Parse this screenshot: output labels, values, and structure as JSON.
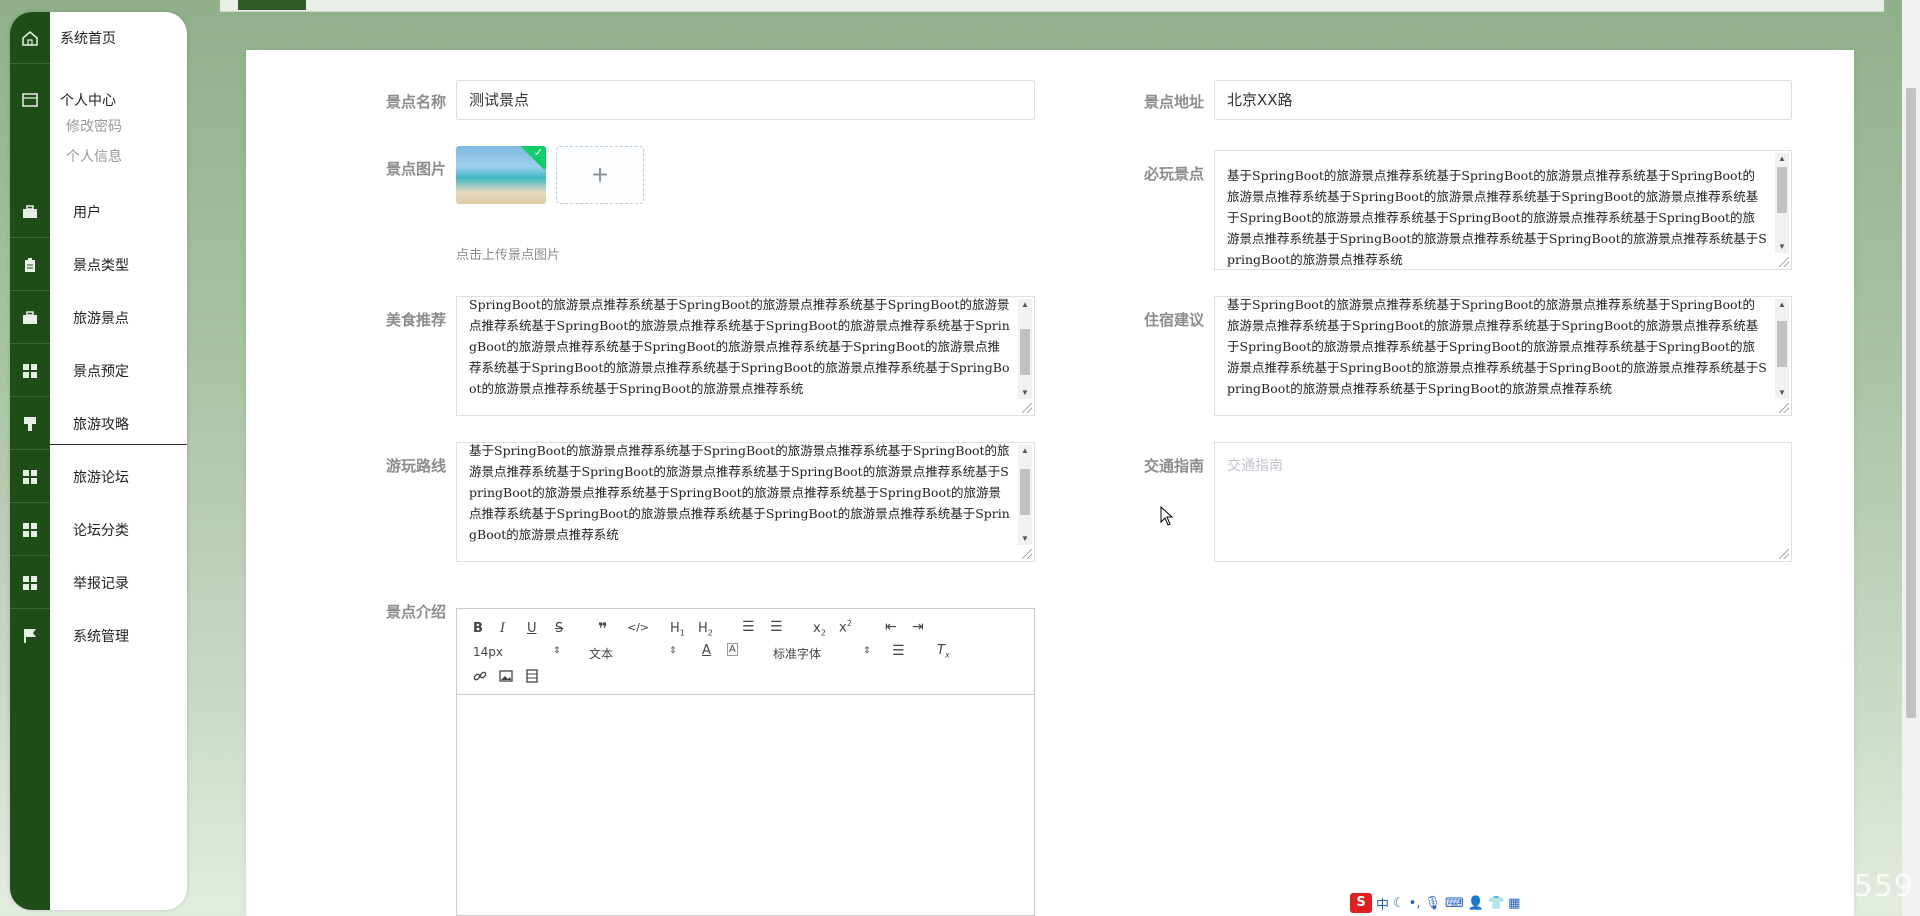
{
  "sidebar": {
    "home": "系统首页",
    "personal_center": "个人中心",
    "change_password": "修改密码",
    "personal_info": "个人信息",
    "items": [
      {
        "label": "用户",
        "icon": "briefcase-icon"
      },
      {
        "label": "景点类型",
        "icon": "clipboard-icon"
      },
      {
        "label": "旅游景点",
        "icon": "briefcase-icon"
      },
      {
        "label": "景点预定",
        "icon": "grid-icon"
      },
      {
        "label": "旅游攻略",
        "icon": "pin-icon"
      },
      {
        "label": "旅游论坛",
        "icon": "grid-icon"
      },
      {
        "label": "论坛分类",
        "icon": "grid-icon"
      },
      {
        "label": "举报记录",
        "icon": "grid-icon"
      },
      {
        "label": "系统管理",
        "icon": "flag-icon"
      }
    ]
  },
  "form": {
    "name_label": "景点名称",
    "name_value": "测试景点",
    "address_label": "景点地址",
    "address_value": "北京XX路",
    "image_label": "景点图片",
    "image_hint": "点击上传景点图片",
    "must_see_label": "必玩景点",
    "must_see_value": "基于SpringBoot的旅游景点推荐系统基于SpringBoot的旅游景点推荐系统基于SpringBoot的旅游景点推荐系统基于SpringBoot的旅游景点推荐系统基于SpringBoot的旅游景点推荐系统基于SpringBoot的旅游景点推荐系统基于SpringBoot的旅游景点推荐系统基于SpringBoot的旅游景点推荐系统基于SpringBoot的旅游景点推荐系统基于SpringBoot的旅游景点推荐系统基于SpringBoot的旅游景点推荐系统",
    "food_label": "美食推荐",
    "food_value": "SpringBoot的旅游景点推荐系统基于SpringBoot的旅游景点推荐系统基于SpringBoot的旅游景点推荐系统基于SpringBoot的旅游景点推荐系统基于SpringBoot的旅游景点推荐系统基于SpringBoot的旅游景点推荐系统基于SpringBoot的旅游景点推荐系统基于SpringBoot的旅游景点推荐系统基于SpringBoot的旅游景点推荐系统基于SpringBoot的旅游景点推荐系统基于SpringBoot的旅游景点推荐系统基于SpringBoot的旅游景点推荐系统",
    "lodging_label": "住宿建议",
    "lodging_value": "基于SpringBoot的旅游景点推荐系统基于SpringBoot的旅游景点推荐系统基于SpringBoot的旅游景点推荐系统基于SpringBoot的旅游景点推荐系统基于SpringBoot的旅游景点推荐系统基于SpringBoot的旅游景点推荐系统基于SpringBoot的旅游景点推荐系统基于SpringBoot的旅游景点推荐系统基于SpringBoot的旅游景点推荐系统基于SpringBoot的旅游景点推荐系统基于SpringBoot的旅游景点推荐系统基于SpringBoot的旅游景点推荐系统",
    "route_label": "游玩路线",
    "route_value": "基于SpringBoot的旅游景点推荐系统基于SpringBoot的旅游景点推荐系统基于SpringBoot的旅游景点推荐系统基于SpringBoot的旅游景点推荐系统基于SpringBoot的旅游景点推荐系统基于SpringBoot的旅游景点推荐系统基于SpringBoot的旅游景点推荐系统基于SpringBoot的旅游景点推荐系统基于SpringBoot的旅游景点推荐系统基于SpringBoot的旅游景点推荐系统基于SpringBoot的旅游景点推荐系统",
    "traffic_label": "交通指南",
    "traffic_placeholder": "交通指南",
    "intro_label": "景点介绍"
  },
  "editor": {
    "font_size": "14px",
    "text_style": "文本",
    "font_family": "标准字体"
  },
  "ime": {
    "mode": "中"
  },
  "watermark": "CSDN @QQ_2079523559",
  "colors": {
    "sidebar_rail": "#1f4d17",
    "accent": "#13ce66"
  }
}
